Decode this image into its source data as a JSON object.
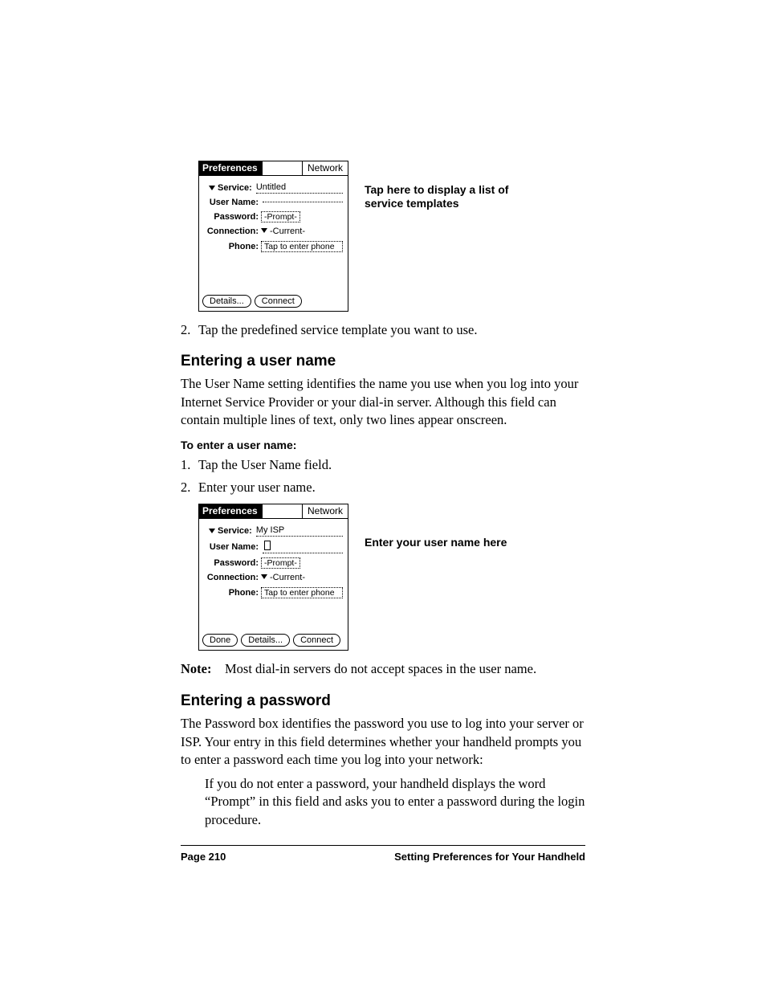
{
  "figure1": {
    "title": "Preferences",
    "tab": "Network",
    "service_label": "Service:",
    "service_value": "Untitled",
    "username_label": "User Name:",
    "username_value": "",
    "password_label": "Password:",
    "password_value": "-Prompt-",
    "connection_label": "Connection:",
    "connection_value": "-Current-",
    "phone_label": "Phone:",
    "phone_value": "Tap to enter phone",
    "btn_details": "Details...",
    "btn_connect": "Connect",
    "annotation": "Tap here to display a list of service templates"
  },
  "step2": "Tap the predefined service template you want to use.",
  "heading1": "Entering a user name",
  "para1": "The User Name setting identifies the name you use when you log into your Internet Service Provider or your dial-in server. Although this field can contain multiple lines of text, only two lines appear onscreen.",
  "sub1": "To enter a user name:",
  "sub1_step1": "Tap the User Name field.",
  "sub1_step2": "Enter your user name.",
  "figure2": {
    "title": "Preferences",
    "tab": "Network",
    "service_label": "Service:",
    "service_value": "My ISP",
    "username_label": "User Name:",
    "password_label": "Password:",
    "password_value": "-Prompt-",
    "connection_label": "Connection:",
    "connection_value": "-Current-",
    "phone_label": "Phone:",
    "phone_value": "Tap to enter phone",
    "btn_done": "Done",
    "btn_details": "Details...",
    "btn_connect": "Connect",
    "annotation": "Enter your user name here"
  },
  "note_label": "Note:",
  "note_text": "Most dial-in servers do not accept spaces in the user name.",
  "heading2": "Entering a password",
  "para2": "The Password box identifies the password you use to log into your server or ISP. Your entry in this field determines whether your handheld prompts you to enter a password each time you log into your network:",
  "indent1": "If you do not enter a password, your handheld displays the word “Prompt” in this field and asks you to enter a password during the login procedure.",
  "footer_left": "Page 210",
  "footer_right": "Setting Preferences for Your Handheld"
}
